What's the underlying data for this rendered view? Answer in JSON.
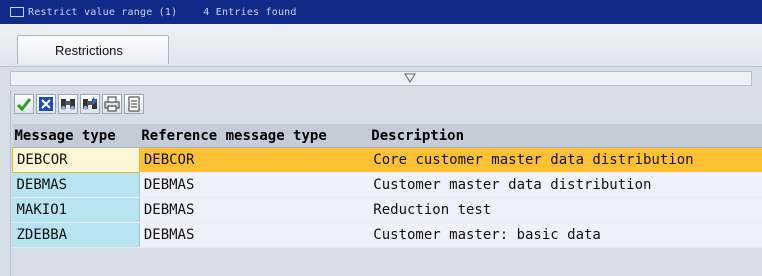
{
  "window": {
    "title": "Restrict value range (1)",
    "entries_found": "4 Entries found"
  },
  "tabs": [
    {
      "label": "Restrictions"
    }
  ],
  "toolbar": {
    "icons": [
      "check-icon",
      "cancel-icon",
      "find-icon",
      "find-next-icon",
      "print-icon",
      "list-icon"
    ]
  },
  "table": {
    "columns": [
      "Message type",
      "Reference message type",
      "Description"
    ],
    "rows": [
      {
        "message_type": "DEBCOR",
        "reference": "DEBCOR",
        "description": "Core customer master data distribution",
        "selected": true
      },
      {
        "message_type": "DEBMAS",
        "reference": "DEBMAS",
        "description": "Customer master data distribution"
      },
      {
        "message_type": "MAKIO1",
        "reference": "DEBMAS",
        "description": "Reduction test"
      },
      {
        "message_type": "ZDEBBA",
        "reference": "DEBMAS",
        "description": "Customer master: basic data"
      }
    ]
  },
  "colors": {
    "title_bar": "#112a87",
    "key_column": "#b8e3f0",
    "selected_row": "#ffc133"
  }
}
